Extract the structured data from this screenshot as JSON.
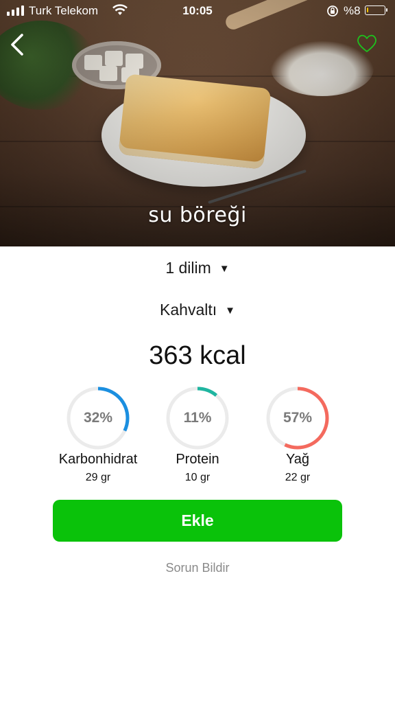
{
  "status_bar": {
    "carrier": "Turk Telekom",
    "time": "10:05",
    "battery_text": "%8",
    "battery_level": 0.08
  },
  "header": {
    "title": "su böreği",
    "back_icon": "chevron-left-icon",
    "favorite_icon": "heart-outline-icon",
    "favorite_color": "#1ec01e"
  },
  "portion": {
    "value": "1  dilim"
  },
  "meal": {
    "value": "Kahvaltı"
  },
  "calories": {
    "label": "363 kcal"
  },
  "macros": [
    {
      "pct_label": "32%",
      "fraction": 0.32,
      "name": "Karbonhidrat",
      "amount": "29 gr",
      "color": "#1b8fe0"
    },
    {
      "pct_label": "11%",
      "fraction": 0.11,
      "name": "Protein",
      "amount": "10 gr",
      "color": "#1fb5a0"
    },
    {
      "pct_label": "57%",
      "fraction": 0.57,
      "name": "Yağ",
      "amount": "22 gr",
      "color": "#f46a5e"
    }
  ],
  "actions": {
    "add_label": "Ekle",
    "add_color": "#0ac20a",
    "report_label": "Sorun Bildir"
  }
}
